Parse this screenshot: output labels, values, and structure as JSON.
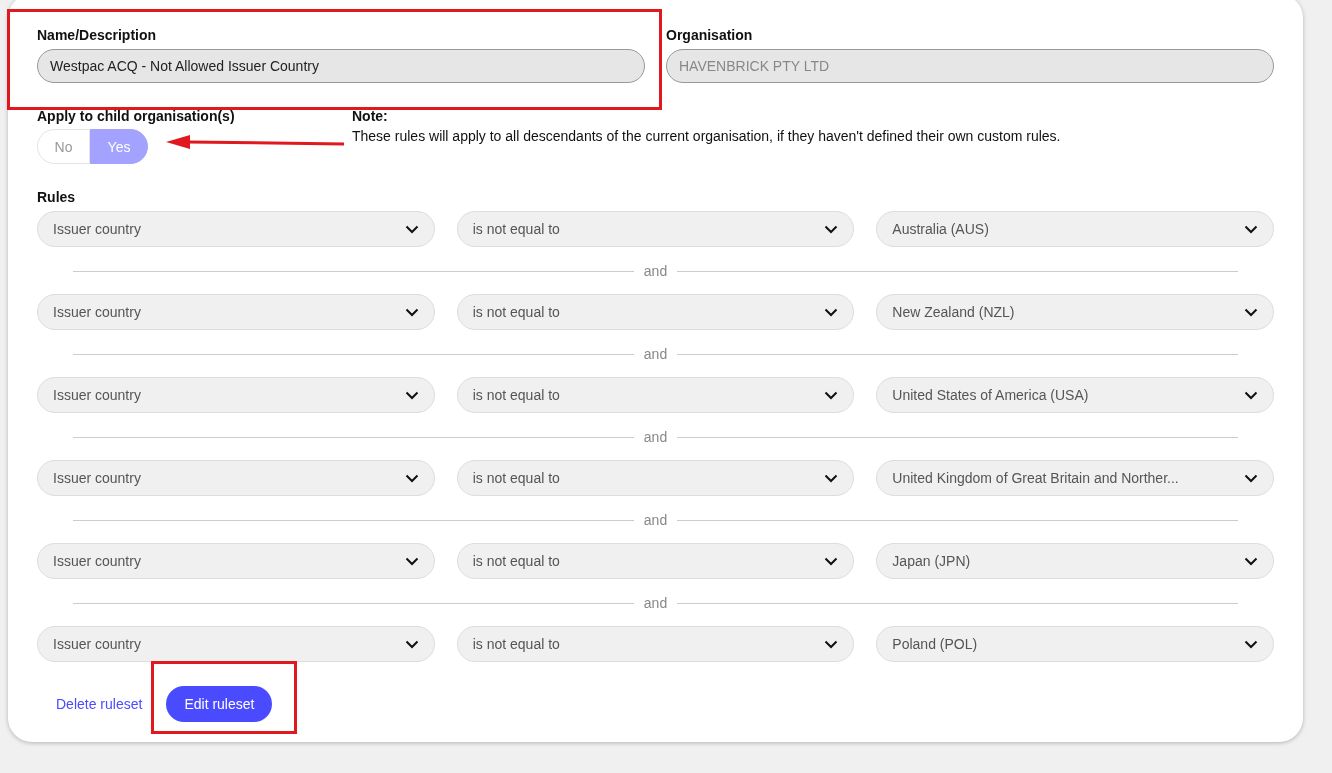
{
  "name_field": {
    "label": "Name/Description",
    "value": "Westpac ACQ - Not Allowed Issuer Country"
  },
  "organisation_field": {
    "label": "Organisation",
    "value": "HAVENBRICK PTY LTD",
    "disabled": true
  },
  "apply_to_child": {
    "label": "Apply to child organisation(s)",
    "options": [
      {
        "label": "No",
        "selected": false
      },
      {
        "label": "Yes",
        "selected": true
      }
    ]
  },
  "note": {
    "title": "Note:",
    "text": "These rules will apply to all descendants of the current organisation, if they haven't defined their own custom rules."
  },
  "rules": {
    "label": "Rules",
    "items": [
      {
        "field": "Issuer country",
        "operator": "is not equal to",
        "value": "Australia (AUS)",
        "connector": "and"
      },
      {
        "field": "Issuer country",
        "operator": "is not equal to",
        "value": "New Zealand (NZL)",
        "connector": "and"
      },
      {
        "field": "Issuer country",
        "operator": "is not equal to",
        "value": "United States of America (USA)",
        "connector": "and"
      },
      {
        "field": "Issuer country",
        "operator": "is not equal to",
        "value": "United Kingdom of Great Britain and Norther...",
        "connector": "and"
      },
      {
        "field": "Issuer country",
        "operator": "is not equal to",
        "value": "Japan (JPN)",
        "connector": "and"
      },
      {
        "field": "Issuer country",
        "operator": "is not equal to",
        "value": "Poland (POL)"
      }
    ]
  },
  "actions": {
    "delete": "Delete ruleset",
    "edit": "Edit ruleset"
  }
}
